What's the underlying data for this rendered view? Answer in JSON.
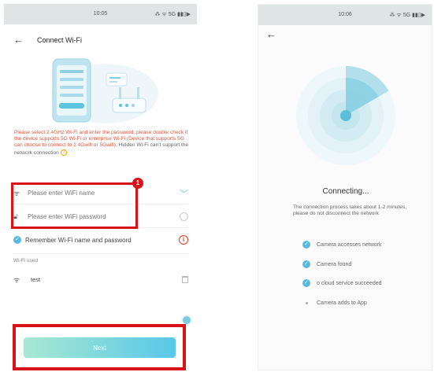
{
  "left": {
    "status": {
      "time": "10:05",
      "signal": "⁂ ᯤ 5G ▮▮▯▶"
    },
    "header": {
      "title": "Connect Wi-Fi"
    },
    "warning": {
      "text": "Please select 2.4GHz Wi-Fi and enter the password, please double check if the device supports 5G Wi-Fi or enterprise Wi-Fi (Device that supports 5G can choose to connect to 2.4Gwifi or 5Gwifi). ",
      "tail": "Hidden Wi-Fi can't support the network connection",
      "help_icon": "question-icon"
    },
    "form": {
      "ssid_placeholder": "Please enter WiFi name",
      "password_placeholder": "Please enter WiFi password",
      "badge": "1"
    },
    "remember": {
      "label": "Remember Wi-Fi name and password",
      "info_glyph": "i"
    },
    "used": {
      "label": "Wi-Fi used",
      "items": [
        {
          "name": "test"
        }
      ]
    },
    "next_label": "Next"
  },
  "right": {
    "status": {
      "time": "10:06",
      "signal": "⁂ ᯤ 5G ▮▮▯▶"
    },
    "connecting_title": "Connecting...",
    "description": "The connection process takes about 1-2 minutes, please do not disconnect the network",
    "steps": [
      {
        "label": "Camera accesses network",
        "done": true
      },
      {
        "label": "Camera found",
        "done": true
      },
      {
        "label": "o cloud service succeeded",
        "done": true
      },
      {
        "label": "Camera adds to App",
        "done": false
      }
    ]
  },
  "colors": {
    "accent": "#5bb8df",
    "highlight": "#d8131a",
    "warning": "#e2553a"
  }
}
